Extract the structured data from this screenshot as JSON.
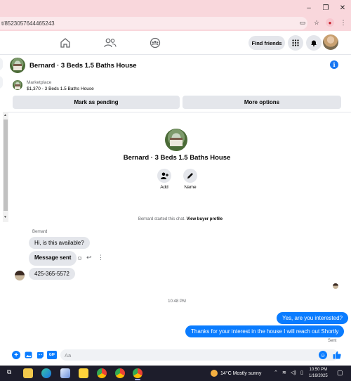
{
  "browser": {
    "url": "t/8523057644465243",
    "window_controls": {
      "minimize": "–",
      "restore": "❐",
      "close": "✕"
    }
  },
  "fb_nav": {
    "find_friends_label": "Find friends"
  },
  "conversation": {
    "title": "Bernard · 3 Beds 1.5 Baths House",
    "marketplace_label": "Marketplace",
    "listing": "$1,370 - 3 Beds 1.5 Baths House",
    "mark_pending_label": "Mark as pending",
    "more_options_label": "More options"
  },
  "profile_card": {
    "name": "Bernard · 3 Beds 1.5 Baths House",
    "add_label": "Add",
    "name_label": "Name"
  },
  "chat": {
    "system_notice": "Bernard started this chat.",
    "system_link": "View buyer profile",
    "sender_name": "Bernard",
    "messages_in": [
      "Hi, is this available?",
      "Message sent",
      "425-365-5572"
    ],
    "timestamp": "10:48 PM",
    "messages_out": [
      "Yes, are you interested?",
      "Thanks for your interest in the house I will reach out Shortly"
    ],
    "sent_status": "Sent"
  },
  "composer": {
    "placeholder": "Aa",
    "gif_label": "GIF"
  },
  "taskbar": {
    "weather": "14°C  Mostly sunny",
    "time": "10:50 PM",
    "date": "1/16/2025"
  },
  "colors": {
    "accent": "#0a7cff",
    "title_bar": "#f9d7dc",
    "taskbar": "#1d1d2b"
  }
}
